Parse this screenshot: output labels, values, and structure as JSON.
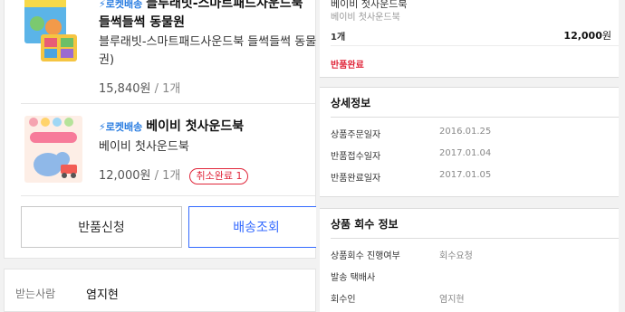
{
  "left": {
    "products": [
      {
        "rocket": "⚡로켓배송",
        "title": "블루래빗-스마트패드사운드북 들썩들썩 동물원",
        "desc": "블루래빗-스마트패드사운드북 들썩들썩 동물 권)",
        "price": "15,840원",
        "qty": "/ 1개"
      },
      {
        "rocket": "⚡로켓배송",
        "title": "베이비 첫사운드북",
        "desc": "베이비 첫사운드북",
        "price": "12,000원",
        "qty": "/ 1개",
        "badge": "취소완료 1"
      }
    ],
    "buttons": {
      "return": "반품신청",
      "shipping": "배송조회"
    },
    "receiver": {
      "label": "받는사람",
      "value": "염지현"
    }
  },
  "right": {
    "top": {
      "item_name": "베이비 첫사운드북",
      "item_sub": "베이비 첫사운드북",
      "qty": "1개",
      "price": "12,000",
      "price_unit": "원",
      "status": "반품완료"
    },
    "detail": {
      "title": "상세정보",
      "rows": [
        {
          "label": "상품주문일자",
          "value": "2016.01.25"
        },
        {
          "label": "반품접수일자",
          "value": "2017.01.04"
        },
        {
          "label": "반품완료일자",
          "value": "2017.01.05"
        }
      ]
    },
    "retrieve": {
      "title": "상품 회수 정보",
      "rows": [
        {
          "label": "상품회수 진행여부",
          "value": "회수요청"
        },
        {
          "label": "발송 택배사",
          "value": ""
        },
        {
          "label": "회수인",
          "value": "염지현"
        }
      ]
    }
  },
  "colors": {
    "accent_blue": "#346aff",
    "rocket_blue": "#2a7de1",
    "alert_red": "#e0263a"
  }
}
